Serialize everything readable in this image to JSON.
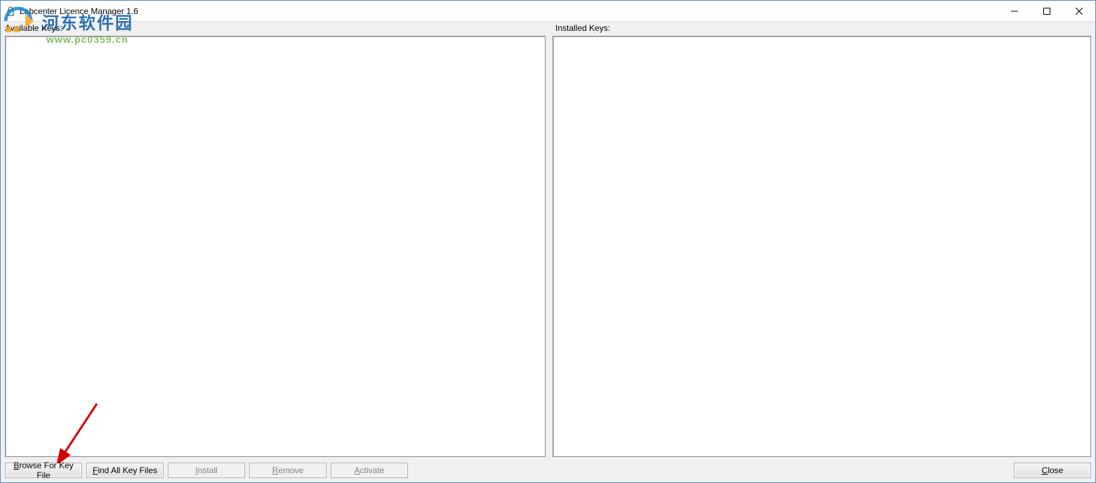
{
  "window": {
    "title": "Labcenter Licence Manager 1.6"
  },
  "panels": {
    "available_label": "Available Keys:",
    "installed_label": "Installed Keys:"
  },
  "buttons": {
    "browse": "Browse For Key File",
    "browse_u": "B",
    "browse_rest": "rowse For Key File",
    "find": "Find All Key Files",
    "find_u": "F",
    "find_rest": "ind All Key Files",
    "install": "Install",
    "install_pre": "",
    "install_u": "I",
    "install_rest": "nstall",
    "remove": "Remove",
    "remove_u": "R",
    "remove_rest": "emove",
    "activate": "Activate",
    "activate_u": "A",
    "activate_rest": "ctivate",
    "close": "Close",
    "close_u": "C",
    "close_rest": "lose"
  },
  "watermark": {
    "cn_text": "河东软件园",
    "url": "www.pc0359.cn"
  }
}
